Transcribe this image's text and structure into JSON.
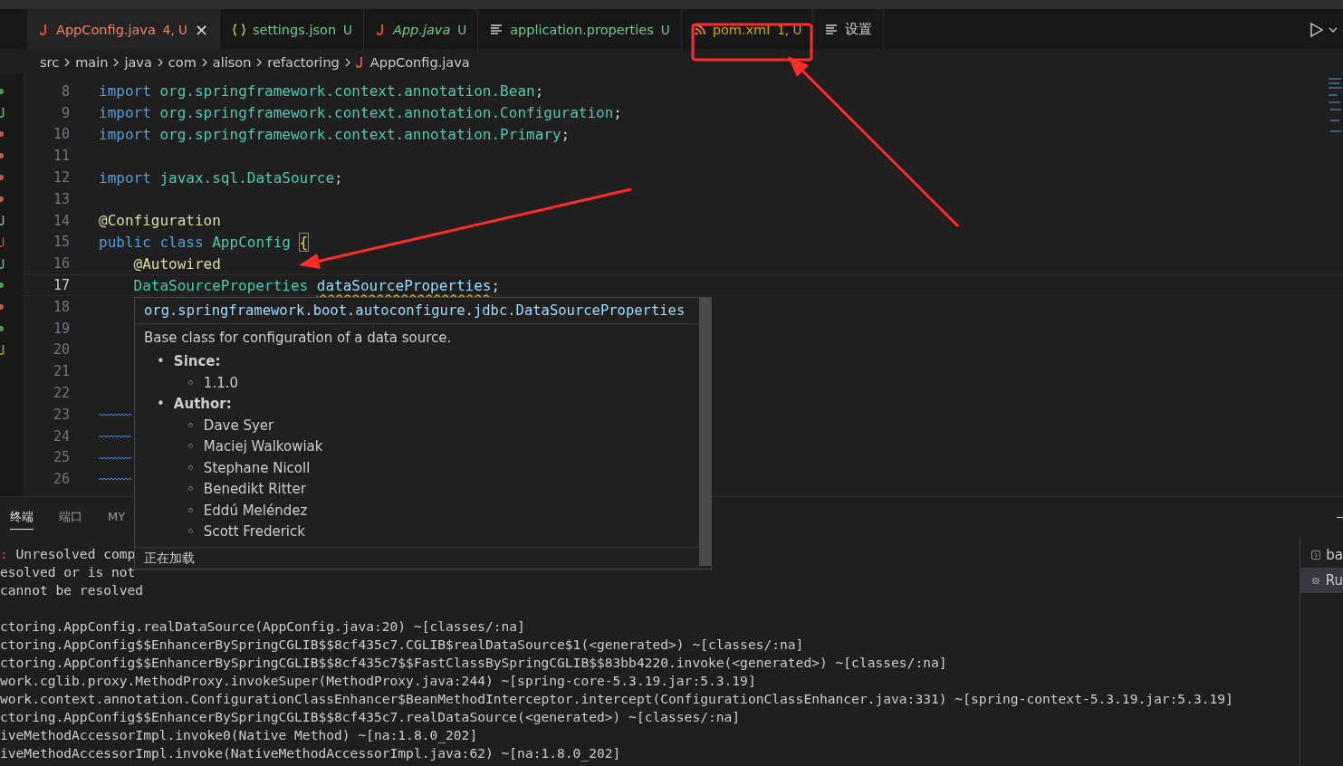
{
  "tabs": [
    {
      "label": "AppConfig.java",
      "badge": "4, U",
      "kind": "java",
      "color": "#f88070",
      "italic": false,
      "selected": true,
      "close": "×"
    },
    {
      "label": "settings.json",
      "badge": "U",
      "kind": "json",
      "color": "#73c991",
      "italic": false,
      "selected": false
    },
    {
      "label": "App.java",
      "badge": "U",
      "kind": "java",
      "color": "#73c991",
      "italic": true,
      "selected": false
    },
    {
      "label": "application.properties",
      "badge": "U",
      "kind": "text",
      "color": "#73c991",
      "italic": false,
      "selected": false
    },
    {
      "label": "pom.xml",
      "badge": "1, U",
      "kind": "xml",
      "color": "#cca700",
      "italic": false,
      "selected": false
    },
    {
      "label": "设置",
      "kind": "text",
      "color": "#cccccc",
      "italic": false,
      "selected": false
    }
  ],
  "breadcrumb": [
    "src",
    "main",
    "java",
    "com",
    "alison",
    "refactoring",
    "AppConfig.java"
  ],
  "gutter_marks": [
    {
      "kind": "dot",
      "color": "#4e9a55"
    },
    {
      "kind": "letter",
      "color": "#73c991"
    },
    {
      "kind": "dot",
      "color": "#b85c4c"
    },
    {
      "kind": "dot",
      "color": "#b85c4c"
    },
    {
      "kind": "dot",
      "color": "#b85c4c"
    },
    {
      "kind": "dot",
      "color": "#b85c4c"
    },
    {
      "kind": "letter",
      "color": "#73c991"
    },
    {
      "kind": "letter",
      "color": "#c74e39"
    },
    {
      "kind": "letter",
      "color": "#73c991"
    },
    {
      "kind": "dot",
      "color": "#4e9a55"
    },
    {
      "kind": "dot",
      "color": "#b85c4c"
    },
    {
      "kind": "dot",
      "color": "#4e9a55"
    },
    {
      "kind": "letter",
      "color": "#cca700"
    }
  ],
  "code_lines": [
    {
      "number": "8",
      "tokens": [
        {
          "kind": "keyword",
          "text": "import "
        },
        {
          "kind": "name",
          "text": "org.springframework.context.annotation.Bean"
        },
        {
          "kind": "plain",
          "text": ";"
        }
      ]
    },
    {
      "number": "9",
      "tokens": [
        {
          "kind": "keyword",
          "text": "import "
        },
        {
          "kind": "name",
          "text": "org.springframework.context.annotation.Configuration"
        },
        {
          "kind": "plain",
          "text": ";"
        }
      ]
    },
    {
      "number": "10",
      "tokens": [
        {
          "kind": "keyword",
          "text": "import "
        },
        {
          "kind": "name",
          "text": "org.springframework.context.annotation.Primary"
        },
        {
          "kind": "plain",
          "text": ";"
        }
      ]
    },
    {
      "number": "11"
    },
    {
      "number": "12",
      "tokens": [
        {
          "kind": "keyword",
          "text": "import "
        },
        {
          "kind": "name",
          "text": "javax.sql.DataSource"
        },
        {
          "kind": "plain",
          "text": ";"
        }
      ]
    },
    {
      "number": "13"
    },
    {
      "number": "14",
      "tokens": [
        {
          "kind": "annotation",
          "text": "@Configuration"
        }
      ]
    },
    {
      "number": "15",
      "tokens": [
        {
          "kind": "keyword",
          "text": "public class "
        },
        {
          "kind": "type",
          "text": "AppConfig "
        },
        {
          "kind": "bracket",
          "text": "{"
        }
      ]
    },
    {
      "number": "16",
      "indented": true,
      "tokens": [
        {
          "kind": "annotation",
          "text": "@Autowired"
        }
      ]
    },
    {
      "number": "17",
      "current": true,
      "indented": true,
      "tokens": [
        {
          "kind": "type",
          "text": "DataSourceProperties "
        },
        {
          "kind": "variable",
          "text": "dataSourceProperties",
          "warning": true
        },
        {
          "kind": "plain",
          "text": ";"
        }
      ]
    },
    {
      "number": "18"
    },
    {
      "number": "19"
    },
    {
      "number": "20"
    },
    {
      "number": "21"
    },
    {
      "number": "22"
    },
    {
      "number": "23",
      "squiggle": true
    },
    {
      "number": "24",
      "squiggle": true
    },
    {
      "number": "25",
      "squiggle": true
    },
    {
      "number": "26",
      "squiggle": true
    }
  ],
  "hover": {
    "signature": "org.springframework.boot.autoconfigure.jdbc.DataSourceProperties",
    "description": "Base class for configuration of a data source.",
    "sections": [
      {
        "marker": "•",
        "heading": "Since:",
        "items": [
          {
            "marker": "◦",
            "text": "1.1.0"
          }
        ]
      },
      {
        "marker": "•",
        "heading": "Author:",
        "items": [
          {
            "marker": "◦",
            "text": "Dave Syer"
          },
          {
            "marker": "◦",
            "text": "Maciej Walkowiak"
          },
          {
            "marker": "◦",
            "text": "Stephane Nicoll"
          },
          {
            "marker": "◦",
            "text": "Benedikt Ritter"
          },
          {
            "marker": "◦",
            "text": "Eddú Meléndez"
          },
          {
            "marker": "◦",
            "text": "Scott Frederick"
          }
        ]
      }
    ],
    "status": "正在加载"
  },
  "panel": {
    "tabs": [
      {
        "label": "终端",
        "selected": true
      },
      {
        "label": "端口",
        "selected": false
      },
      {
        "label": "MY",
        "selected": false
      }
    ],
    "terminal_lines": [
      {
        "prefix": ":",
        "text": " Unresolved comp"
      },
      {
        "text": "esolved or is not"
      },
      {
        "text": "cannot be resolved"
      },
      {
        "gap_before": true,
        "text": "ctoring.AppConfig.realDataSource(AppConfig.java:20) ~[classes/:na]"
      },
      {
        "text": "ctoring.AppConfig$$EnhancerBySpringCGLIB$$8cf435c7.CGLIB$realDataSource$1(<generated>) ~[classes/:na]"
      },
      {
        "text": "ctoring.AppConfig$$EnhancerBySpringCGLIB$$8cf435c7$$FastClassBySpringCGLIB$$83bb4220.invoke(<generated>) ~[classes/:na]"
      },
      {
        "text": "work.cglib.proxy.MethodProxy.invokeSuper(MethodProxy.java:244) ~[spring-core-5.3.19.jar:5.3.19]"
      },
      {
        "text": "work.context.annotation.ConfigurationClassEnhancer$BeanMethodInterceptor.intercept(ConfigurationClassEnhancer.java:331) ~[spring-context-5.3.19.jar:5.3.19]"
      },
      {
        "text": "ctoring.AppConfig$$EnhancerBySpringCGLIB$$8cf435c7.realDataSource(<generated>) ~[classes/:na]"
      },
      {
        "text": "iveMethodAccessorImpl.invoke0(Native Method) ~[na:1.8.0_202]"
      },
      {
        "text": "iveMethodAccessorImpl.invoke(NativeMethodAccessorImpl.java:62) ~[na:1.8.0_202]"
      }
    ],
    "sessions": [
      {
        "label": "ba",
        "kind": "shell",
        "selected": false
      },
      {
        "label": "Ru",
        "kind": "debug",
        "selected": true
      }
    ]
  }
}
